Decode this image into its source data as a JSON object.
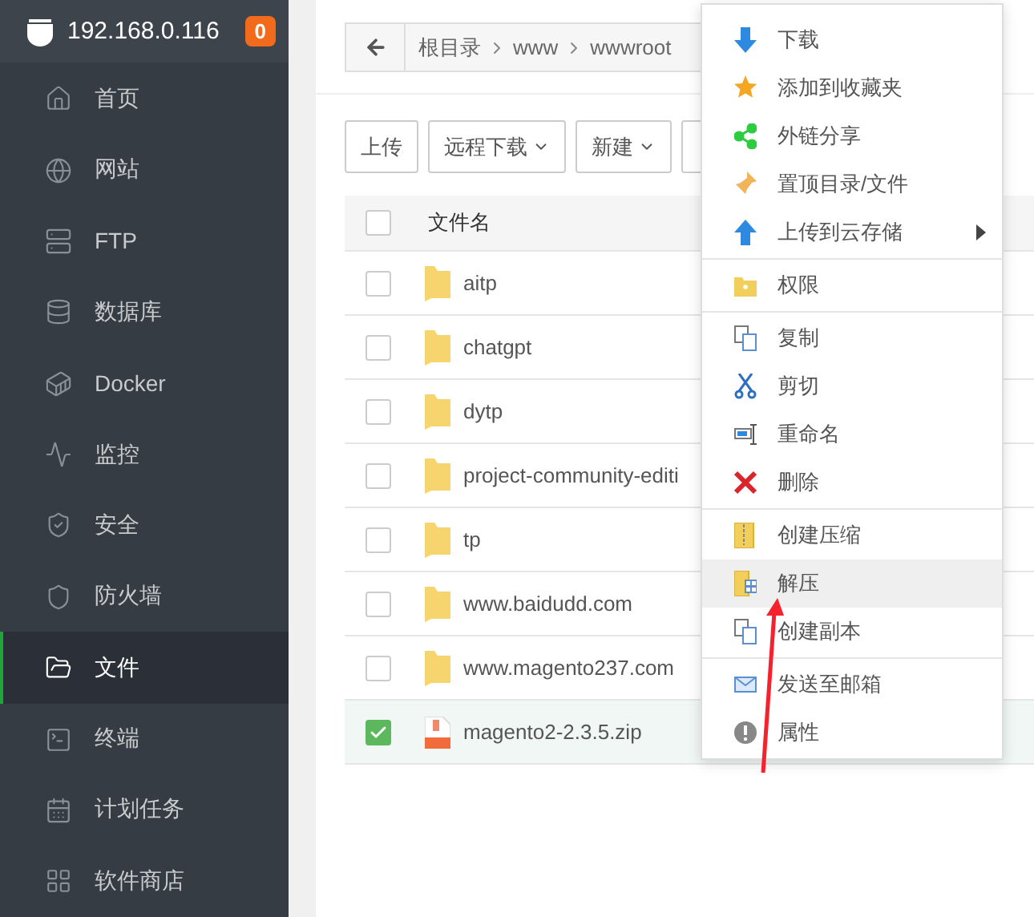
{
  "sidebar": {
    "host": "192.168.0.116",
    "badge": "0",
    "items": [
      {
        "label": "首页",
        "selected": false
      },
      {
        "label": "网站",
        "selected": false
      },
      {
        "label": "FTP",
        "selected": false
      },
      {
        "label": "数据库",
        "selected": false
      },
      {
        "label": "Docker",
        "selected": false
      },
      {
        "label": "监控",
        "selected": false
      },
      {
        "label": "安全",
        "selected": false
      },
      {
        "label": "防火墙",
        "selected": false
      },
      {
        "label": "文件",
        "selected": true
      },
      {
        "label": "终端",
        "selected": false
      },
      {
        "label": "计划任务",
        "selected": false
      },
      {
        "label": "软件商店",
        "selected": false
      }
    ]
  },
  "breadcrumb": [
    "根目录",
    "www",
    "wwwroot"
  ],
  "toolbar": [
    {
      "label": "上传",
      "dropdown": false
    },
    {
      "label": "远程下载",
      "dropdown": true
    },
    {
      "label": "新建",
      "dropdown": true
    }
  ],
  "table": {
    "columns": [
      "文件名"
    ],
    "header_checked": false,
    "rows": [
      {
        "name": "aitp",
        "kind": "folder",
        "checked": false
      },
      {
        "name": "chatgpt",
        "kind": "folder",
        "checked": false
      },
      {
        "name": "dytp",
        "kind": "folder",
        "checked": false
      },
      {
        "name": "project-community-editi",
        "kind": "folder",
        "checked": false
      },
      {
        "name": "tp",
        "kind": "folder",
        "checked": false
      },
      {
        "name": "www.baidudd.com",
        "kind": "folder",
        "checked": false
      },
      {
        "name": "www.magento237.com",
        "kind": "folder",
        "checked": false
      },
      {
        "name": "magento2-2.3.5.zip",
        "kind": "zip",
        "checked": true
      }
    ]
  },
  "context_menu": {
    "groups": [
      [
        {
          "label": "下载",
          "selected": false,
          "submenu": false
        },
        {
          "label": "添加到收藏夹",
          "selected": false,
          "submenu": false
        },
        {
          "label": "外链分享",
          "selected": false,
          "submenu": false
        },
        {
          "label": "置顶目录/文件",
          "selected": false,
          "submenu": false
        },
        {
          "label": "上传到云存储",
          "selected": false,
          "submenu": true
        }
      ],
      [
        {
          "label": "权限",
          "selected": false,
          "submenu": false
        }
      ],
      [
        {
          "label": "复制",
          "selected": false,
          "submenu": false
        },
        {
          "label": "剪切",
          "selected": false,
          "submenu": false
        },
        {
          "label": "重命名",
          "selected": false,
          "submenu": false
        },
        {
          "label": "删除",
          "selected": false,
          "submenu": false
        }
      ],
      [
        {
          "label": "创建压缩",
          "selected": false,
          "submenu": false
        },
        {
          "label": "解压",
          "selected": true,
          "submenu": false
        },
        {
          "label": "创建副本",
          "selected": false,
          "submenu": false
        }
      ],
      [
        {
          "label": "发送至邮箱",
          "selected": false,
          "submenu": false
        },
        {
          "label": "属性",
          "selected": false,
          "submenu": false
        }
      ]
    ]
  }
}
